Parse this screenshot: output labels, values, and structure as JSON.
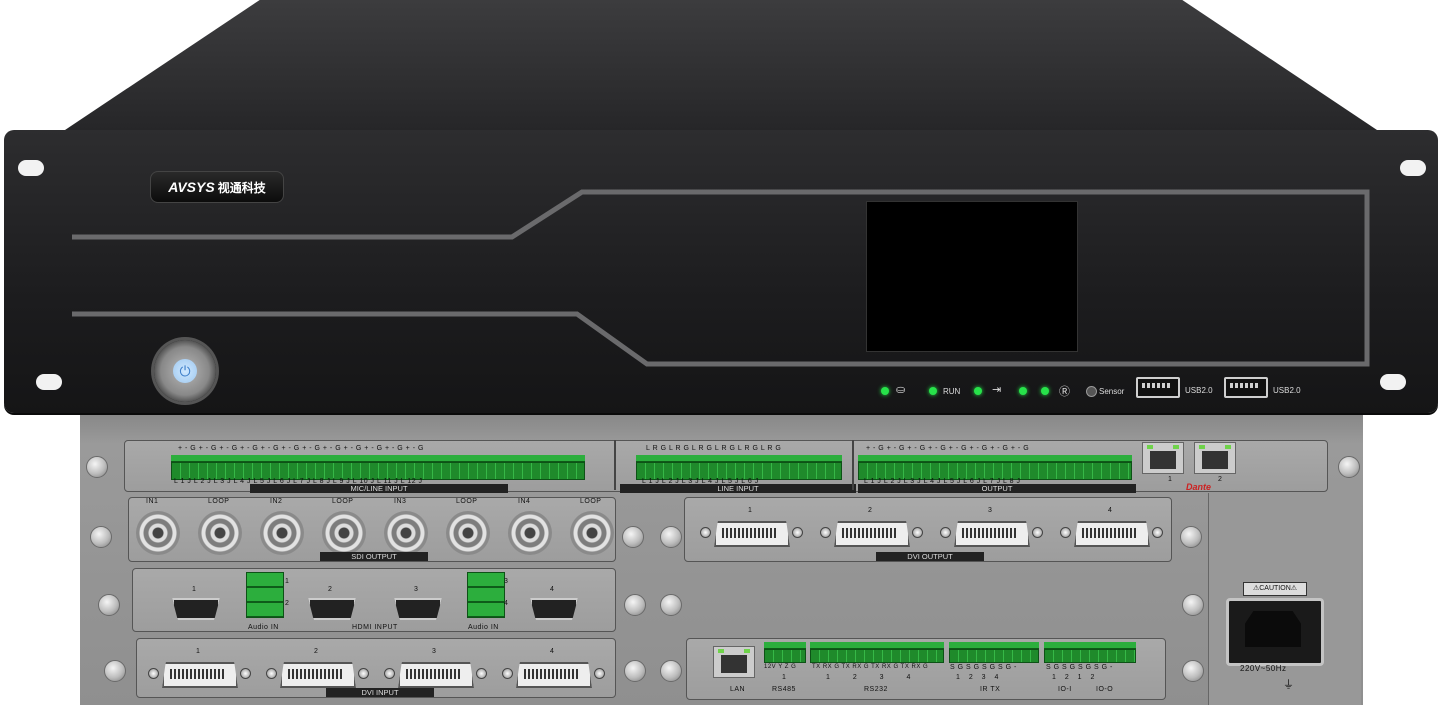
{
  "brand": {
    "name": "AVSYS",
    "chinese_name": "视通科技"
  },
  "front": {
    "status_labels": {
      "run": "RUN",
      "sensor": "Sensor"
    },
    "usb_ports": [
      "USB2.0",
      "USB2.0"
    ],
    "icons": [
      "network-icon",
      "input-icon",
      "ir-icon"
    ]
  },
  "rear": {
    "mic_line_input": {
      "label": "MIC/LINE INPUT",
      "polarity": "+ - G + - G + - G + - G + - G + - G + - G + - G + - G + - G + - G + - G",
      "channels": "L 1 J L 2 J L 3 J L 4 J L 5 J L 6 J L 7 J L 8 J L 9 J L 10 J L 11 J L 12 J"
    },
    "line_input": {
      "label": "LINE INPUT",
      "polarity": "L R G L R G L R G L R G L R G L R G",
      "channels": "L 1 J L 2 J L 3 J L 4 J L 5 J L 6 J"
    },
    "output": {
      "label": "OUTPUT",
      "polarity": "+ - G + - G + - G + - G + - G + - G + - G + - G",
      "channels": "L 1 J L 2 J L 3 J L 4 J L 5 J L 6 J L 7 J L 8 J"
    },
    "dante": {
      "label": "Dante",
      "ports": [
        "1",
        "2"
      ]
    },
    "sdi": {
      "label": "SDI OUTPUT",
      "ports": [
        "IN1",
        "LOOP",
        "IN2",
        "LOOP",
        "IN3",
        "LOOP",
        "IN4",
        "LOOP"
      ]
    },
    "dvi_output": {
      "label": "DVI OUTPUT",
      "ports": [
        "1",
        "2",
        "3",
        "4"
      ]
    },
    "hdmi_input": {
      "label": "HDMI INPUT",
      "ports": [
        "1",
        "2",
        "3",
        "4"
      ],
      "audio_in": "Audio IN",
      "audio_nums_a": [
        "1",
        "2"
      ],
      "audio_nums_b": [
        "3",
        "4"
      ]
    },
    "dvi_input": {
      "label": "DVI INPUT",
      "ports": [
        "1",
        "2",
        "3",
        "4"
      ]
    },
    "control": {
      "lan": "LAN",
      "rs485": {
        "label": "RS485",
        "pins": "12V Y Z G",
        "num": "1"
      },
      "rs232": {
        "label": "RS232",
        "pins": "TX RX G TX RX G TX RX G TX RX G",
        "nums": "1 2 3 4"
      },
      "ir": {
        "label": "IR TX",
        "pins": "S G S G S G S G -",
        "nums": "1 2 3 4"
      },
      "io": {
        "label_in": "IO-I",
        "label_out": "IO-O",
        "pins": "S G S G S G S G -",
        "nums": "1 2 1 2"
      }
    },
    "power": {
      "caution": "CAUTION",
      "rating": "220V~50Hz"
    }
  },
  "colors": {
    "chassis": "#1c1c1e",
    "rear": "#9a9a9a",
    "terminal": "#2cae3d",
    "led": "#27e24a"
  }
}
